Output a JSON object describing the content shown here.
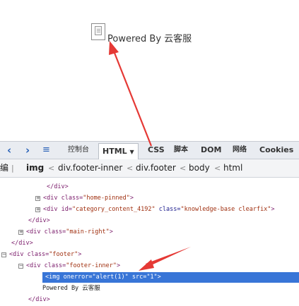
{
  "preview": {
    "powered_text": "Powered By 云客服"
  },
  "toolbar": {
    "console_tab": "控制台",
    "html_tab": "HTML",
    "css_tab": "CSS",
    "script_tab": "脚本",
    "dom_tab": "DOM",
    "net_tab": "网络",
    "cookies_tab": "Cookies"
  },
  "breadcrumb": {
    "edit": "编",
    "items": [
      "img",
      "div.footer-inner",
      "div.footer",
      "body",
      "html"
    ]
  },
  "tree": {
    "lines": [
      {
        "tag": "</div>"
      },
      {
        "open": "<div class=",
        "val": "\"home-pinned\"",
        "close": ">"
      },
      {
        "open": "<div id=",
        "val": "\"category_content_4192\"",
        "mid": " class=",
        "val2": "\"knowledge-base clearfix\"",
        "close": ">"
      },
      {
        "tag": "</div>"
      },
      {
        "open": "<div class=",
        "val": "\"main-right\"",
        "close": ">"
      },
      {
        "tag": "</div>"
      },
      {
        "open": "<div class=",
        "val": "\"footer\"",
        "close": ">"
      },
      {
        "open": "<div class=",
        "val": "\"footer-inner\"",
        "close": ">"
      },
      {
        "open": "<img onerror=",
        "val": "\"alert(1)\"",
        "mid": " src=",
        "val2": "\"1\"",
        "close": ">"
      },
      {
        "text": "Powered By 云客服"
      },
      {
        "tag": "</div>"
      }
    ]
  },
  "colors": {
    "selection": "#3875d7",
    "arrow": "#e53935"
  }
}
